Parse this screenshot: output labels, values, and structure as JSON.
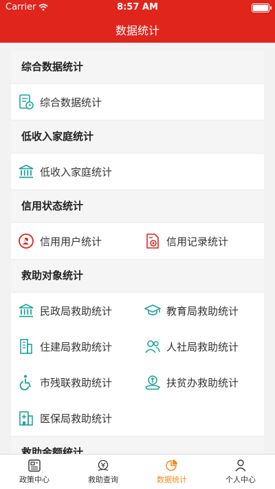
{
  "status": {
    "carrier": "Carrier",
    "time": "8:57 AM"
  },
  "header": {
    "title": "数据统计"
  },
  "sections": [
    {
      "title": "综合数据统计",
      "items": [
        "综合数据统计"
      ]
    },
    {
      "title": "低收入家庭统计",
      "items": [
        "低收入家庭统计"
      ]
    },
    {
      "title": "信用状态统计",
      "items": [
        "信用用户统计",
        "信用记录统计"
      ]
    },
    {
      "title": "救助对象统计",
      "items": [
        "民政局救助统计",
        "教育局救助统计",
        "住建局救助统计",
        "人社局救助统计",
        "市残联救助统计",
        "扶贫办救助统计",
        "医保局救助统计"
      ]
    },
    {
      "title": "救助金额统计"
    }
  ],
  "tabs": [
    "政策中心",
    "救助查询",
    "数据统计",
    "个人中心"
  ],
  "colors": {
    "header": "#e0251c",
    "teal": "#1aa39a",
    "red": "#e0251c",
    "active_tab": "#f58a21"
  }
}
